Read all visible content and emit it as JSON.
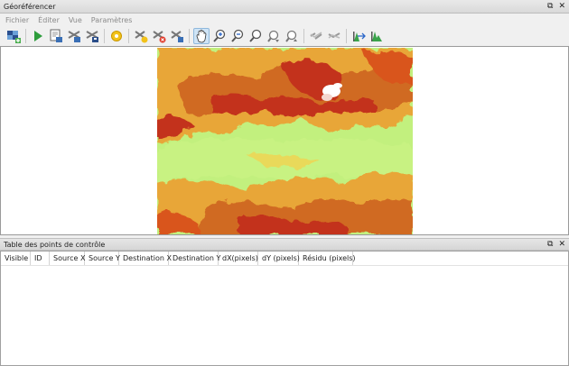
{
  "window": {
    "title": "Géoréférencer",
    "float_icon": "restore-icon",
    "close_icon": "close-icon"
  },
  "menu": [
    "Fichier",
    "Éditer",
    "Vue",
    "Paramètres"
  ],
  "toolbar": {
    "icons": [
      "open-raster-icon",
      "start-georef-icon",
      "generate-script-icon",
      "load-gcp-icon",
      "save-gcp-icon",
      "transform-settings-icon",
      "add-point-icon",
      "delete-point-icon",
      "move-gcp-icon",
      "pan-icon",
      "zoom-in-icon",
      "zoom-out-icon",
      "zoom-to-layer-icon",
      "zoom-last-icon",
      "zoom-next-icon",
      "link-georef-icon",
      "link-qgis-icon",
      "full-histogram-stretch-icon",
      "local-histogram-stretch-icon"
    ]
  },
  "gcp_panel": {
    "title": "Table des points de contrôle",
    "columns": [
      "Visible",
      "ID",
      "Source X",
      "Source Y",
      "Destination X",
      "Destination Y",
      "dX(pixels)",
      "dY (pixels)",
      "Résidu (pixels)"
    ]
  },
  "colors": {
    "lowland": "#b8f07a",
    "mid": "#e6a032",
    "high": "#c0351a",
    "peak": "#ffffff"
  }
}
